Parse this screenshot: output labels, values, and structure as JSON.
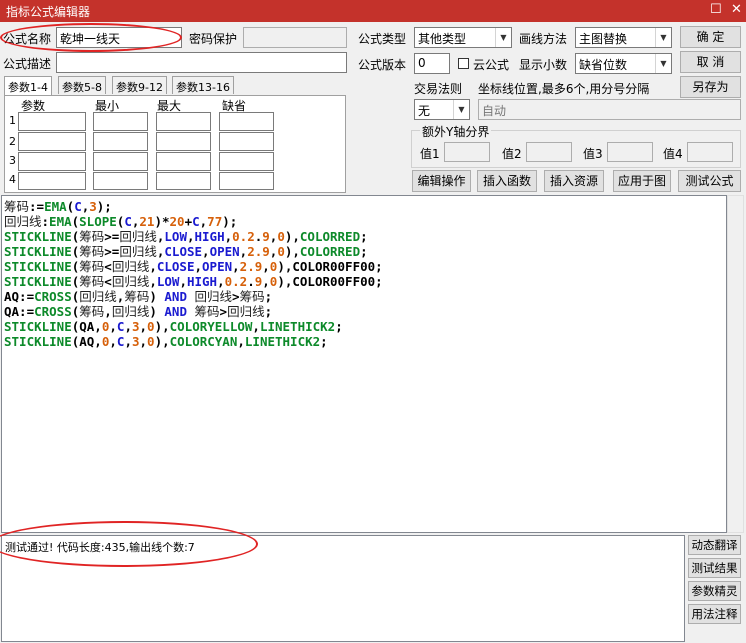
{
  "window": {
    "title": "指标公式编辑器",
    "restore_glyph": "☐",
    "close_glyph": "✕"
  },
  "form": {
    "name_label": "公式名称",
    "name_value": "乾坤一线天",
    "password_label": "密码保护",
    "description_label": "公式描述",
    "description_value": "",
    "type_label": "公式类型",
    "type_value": "其他类型",
    "draw_label": "画线方法",
    "draw_value": "主图替换",
    "version_label": "公式版本",
    "version_value": "0",
    "cloud_label": "云公式",
    "decimal_label": "显示小数",
    "decimal_value": "缺省位数",
    "trade_rule_label": "交易法则",
    "trade_rule_value": "无",
    "coord_label": "坐标线位置,最多6个,用分号分隔",
    "coord_value": "自动",
    "extra_y_label": "额外Y轴分界",
    "extra_y_values": [
      "值1",
      "值2",
      "值3",
      "值4"
    ]
  },
  "buttons": {
    "ok": "确  定",
    "cancel": "取  消",
    "save_as": "另存为",
    "edit_op": "编辑操作",
    "insert_func": "插入函数",
    "insert_res": "插入资源",
    "apply_chart": "应用于图",
    "test_formula": "测试公式",
    "dyn_translate": "动态翻译",
    "test_result": "测试结果",
    "param_wizard": "参数精灵",
    "usage_note": "用法注释"
  },
  "param_tabs": [
    "参数1-4",
    "参数5-8",
    "参数9-12",
    "参数13-16"
  ],
  "param_headers": [
    "参数",
    "最小",
    "最大",
    "缺省"
  ],
  "param_rows": [
    "1",
    "2",
    "3",
    "4"
  ],
  "code_lines": [
    [
      [
        "c-chr",
        "筹码"
      ],
      [
        "c-op",
        ":="
      ],
      [
        "c-grn",
        "EMA"
      ],
      [
        "c-op",
        "("
      ],
      [
        "c-blu",
        "C"
      ],
      [
        "c-op",
        ","
      ],
      [
        "c-num",
        "3"
      ],
      [
        "c-op",
        ");"
      ]
    ],
    [
      [
        "c-chr",
        "回归线"
      ],
      [
        "c-op",
        ":"
      ],
      [
        "c-grn",
        "EMA"
      ],
      [
        "c-op",
        "("
      ],
      [
        "c-grn",
        "SLOPE"
      ],
      [
        "c-op",
        "("
      ],
      [
        "c-blu",
        "C"
      ],
      [
        "c-op",
        ","
      ],
      [
        "c-num",
        "21"
      ],
      [
        "c-op",
        ")*"
      ],
      [
        "c-num",
        "20"
      ],
      [
        "c-op",
        "+"
      ],
      [
        "c-blu",
        "C"
      ],
      [
        "c-op",
        ","
      ],
      [
        "c-num",
        "77"
      ],
      [
        "c-op",
        ");"
      ]
    ],
    [
      [
        "c-grn",
        "STICKLINE"
      ],
      [
        "c-op",
        "("
      ],
      [
        "c-chr",
        "筹码"
      ],
      [
        "c-op",
        ">="
      ],
      [
        "c-chr",
        "回归线"
      ],
      [
        "c-op",
        ","
      ],
      [
        "c-blu",
        "LOW"
      ],
      [
        "c-op",
        ","
      ],
      [
        "c-blu",
        "HIGH"
      ],
      [
        "c-op",
        ","
      ],
      [
        "c-num",
        "0.2"
      ],
      [
        "c-op",
        "."
      ],
      [
        "c-num",
        "9"
      ],
      [
        "c-op",
        ","
      ],
      [
        "c-num",
        "0"
      ],
      [
        "c-op",
        "),"
      ],
      [
        "c-grn",
        "COLORRED"
      ],
      [
        "c-op",
        ";"
      ]
    ],
    [
      [
        "c-grn",
        "STICKLINE"
      ],
      [
        "c-op",
        "("
      ],
      [
        "c-chr",
        "筹码"
      ],
      [
        "c-op",
        ">="
      ],
      [
        "c-chr",
        "回归线"
      ],
      [
        "c-op",
        ","
      ],
      [
        "c-blu",
        "CLOSE"
      ],
      [
        "c-op",
        ","
      ],
      [
        "c-blu",
        "OPEN"
      ],
      [
        "c-op",
        ","
      ],
      [
        "c-num",
        "2.9"
      ],
      [
        "c-op",
        ","
      ],
      [
        "c-num",
        "0"
      ],
      [
        "c-op",
        "),"
      ],
      [
        "c-grn",
        "COLORRED"
      ],
      [
        "c-op",
        ";"
      ]
    ],
    [
      [
        "c-grn",
        "STICKLINE"
      ],
      [
        "c-op",
        "("
      ],
      [
        "c-chr",
        "筹码"
      ],
      [
        "c-op",
        "<"
      ],
      [
        "c-chr",
        "回归线"
      ],
      [
        "c-op",
        ","
      ],
      [
        "c-blu",
        "CLOSE"
      ],
      [
        "c-op",
        ","
      ],
      [
        "c-blu",
        "OPEN"
      ],
      [
        "c-op",
        ","
      ],
      [
        "c-num",
        "2.9"
      ],
      [
        "c-op",
        ","
      ],
      [
        "c-num",
        "0"
      ],
      [
        "c-op",
        "),"
      ],
      [
        "c-op",
        "COLOR00FF00;"
      ]
    ],
    [
      [
        "c-grn",
        "STICKLINE"
      ],
      [
        "c-op",
        "("
      ],
      [
        "c-chr",
        "筹码"
      ],
      [
        "c-op",
        "<"
      ],
      [
        "c-chr",
        "回归线"
      ],
      [
        "c-op",
        ","
      ],
      [
        "c-blu",
        "LOW"
      ],
      [
        "c-op",
        ","
      ],
      [
        "c-blu",
        "HIGH"
      ],
      [
        "c-op",
        ","
      ],
      [
        "c-num",
        "0.2"
      ],
      [
        "c-op",
        "."
      ],
      [
        "c-num",
        "9"
      ],
      [
        "c-op",
        ","
      ],
      [
        "c-num",
        "0"
      ],
      [
        "c-op",
        "),"
      ],
      [
        "c-op",
        "COLOR00FF00;"
      ]
    ],
    [
      [
        "c-op",
        "AQ:="
      ],
      [
        "c-grn",
        "CROSS"
      ],
      [
        "c-op",
        "("
      ],
      [
        "c-chr",
        "回归线"
      ],
      [
        "c-op",
        ","
      ],
      [
        "c-chr",
        "筹码"
      ],
      [
        "c-op",
        ") "
      ],
      [
        "c-blu",
        "AND"
      ],
      [
        "c-op",
        " "
      ],
      [
        "c-chr",
        "回归线"
      ],
      [
        "c-op",
        ">"
      ],
      [
        "c-chr",
        "筹码"
      ],
      [
        "c-op",
        ";"
      ]
    ],
    [
      [
        "c-op",
        "QA:="
      ],
      [
        "c-grn",
        "CROSS"
      ],
      [
        "c-op",
        "("
      ],
      [
        "c-chr",
        "筹码"
      ],
      [
        "c-op",
        ","
      ],
      [
        "c-chr",
        "回归线"
      ],
      [
        "c-op",
        ") "
      ],
      [
        "c-blu",
        "AND"
      ],
      [
        "c-op",
        " "
      ],
      [
        "c-chr",
        "筹码"
      ],
      [
        "c-op",
        ">"
      ],
      [
        "c-chr",
        "回归线"
      ],
      [
        "c-op",
        ";"
      ]
    ],
    [
      [
        "c-grn",
        "STICKLINE"
      ],
      [
        "c-op",
        "(QA,"
      ],
      [
        "c-num",
        "0"
      ],
      [
        "c-op",
        ","
      ],
      [
        "c-blu",
        "C"
      ],
      [
        "c-op",
        ","
      ],
      [
        "c-num",
        "3"
      ],
      [
        "c-op",
        ","
      ],
      [
        "c-num",
        "0"
      ],
      [
        "c-op",
        "),"
      ],
      [
        "c-grn",
        "COLORYELLOW"
      ],
      [
        "c-op",
        ","
      ],
      [
        "c-grn",
        "LINETHICK2"
      ],
      [
        "c-op",
        ";"
      ]
    ],
    [
      [
        "c-grn",
        "STICKLINE"
      ],
      [
        "c-op",
        "(AQ,"
      ],
      [
        "c-num",
        "0"
      ],
      [
        "c-op",
        ","
      ],
      [
        "c-blu",
        "C"
      ],
      [
        "c-op",
        ","
      ],
      [
        "c-num",
        "3"
      ],
      [
        "c-op",
        ","
      ],
      [
        "c-num",
        "0"
      ],
      [
        "c-op",
        "),"
      ],
      [
        "c-grn",
        "COLORCYAN"
      ],
      [
        "c-op",
        ","
      ],
      [
        "c-grn",
        "LINETHICK2"
      ],
      [
        "c-op",
        ";"
      ]
    ]
  ],
  "output_text": "测试通过! 代码长度:435,输出线个数:7"
}
